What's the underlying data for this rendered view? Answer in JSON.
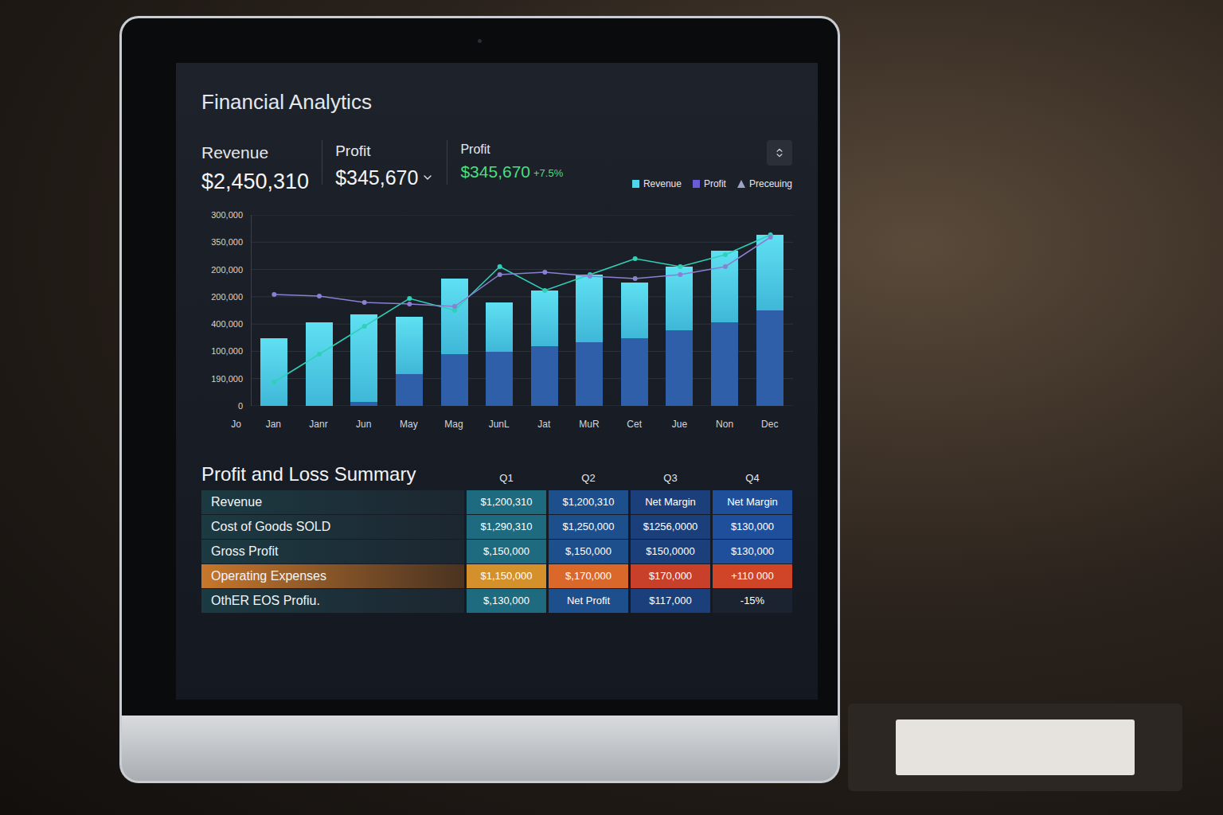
{
  "app": {
    "title": "Financial Analytics"
  },
  "kpis": [
    {
      "label": "Revenue",
      "value": "$2,450,310",
      "change": "",
      "dropdown": false,
      "positive": false
    },
    {
      "label": "Profit",
      "value": "$345,670",
      "change": "",
      "dropdown": true,
      "positive": false
    },
    {
      "label": "Profit",
      "value": "$345,670",
      "change": "+7.5%",
      "dropdown": false,
      "positive": true
    }
  ],
  "chart": {
    "legend": [
      {
        "label": "Revenue",
        "color": "#4fd6ec",
        "kind": "square"
      },
      {
        "label": "Profit",
        "color": "#6a5cd8",
        "kind": "square"
      },
      {
        "label": "Preceuing",
        "color": "#9aa3c8",
        "kind": "triangle"
      }
    ],
    "y_ticks": [
      "300,000",
      "350,000",
      "200,000",
      "200,000",
      "400,000",
      "100,000",
      "190,000",
      "0"
    ],
    "x_origin_label": "Jo",
    "bars": [
      {
        "label": "Jan",
        "total": 85000,
        "lower": 0
      },
      {
        "label": "Janr",
        "total": 105000,
        "lower": 0
      },
      {
        "label": "Jun",
        "total": 115000,
        "lower": 5000
      },
      {
        "label": "May",
        "total": 112000,
        "lower": 40000
      },
      {
        "label": "Mag",
        "total": 160000,
        "lower": 65000
      },
      {
        "label": "JunL",
        "total": 130000,
        "lower": 68000
      },
      {
        "label": "Jat",
        "total": 145000,
        "lower": 75000
      },
      {
        "label": "MuR",
        "total": 165000,
        "lower": 80000
      },
      {
        "label": "Cet",
        "total": 155000,
        "lower": 85000
      },
      {
        "label": "Jue",
        "total": 175000,
        "lower": 95000
      },
      {
        "label": "Non",
        "total": 195000,
        "lower": 105000
      },
      {
        "label": "Dec",
        "total": 215000,
        "lower": 120000
      }
    ],
    "lines": [
      {
        "color": "#2fd0b8",
        "values": [
          30000,
          65000,
          100000,
          135000,
          120000,
          175000,
          145000,
          165000,
          185000,
          175000,
          190000,
          215000
        ]
      },
      {
        "color": "#8a7fd0",
        "values": [
          140000,
          138000,
          130000,
          128000,
          125000,
          165000,
          168000,
          163000,
          160000,
          165000,
          175000,
          212000
        ]
      }
    ]
  },
  "table": {
    "title": "Profit and Loss Summary",
    "rows": [
      {
        "label": "Revenue",
        "highlighted": false
      },
      {
        "label": "Cost of Goods SOLD",
        "highlighted": false
      },
      {
        "label": "Gross Profit",
        "highlighted": false
      },
      {
        "label": "Operating Expenses",
        "highlighted": true
      },
      {
        "label": "OthER EOS Profiu.",
        "highlighted": false
      }
    ],
    "columns": [
      {
        "label": "Q1",
        "cells": [
          {
            "text": "$1,200,310",
            "color": "#1e6b80"
          },
          {
            "text": "$1,290,310",
            "color": "#1e6b80"
          },
          {
            "text": "$,150,000",
            "color": "#1e6b80"
          },
          {
            "text": "$1,150,000",
            "color": "#d4902a"
          },
          {
            "text": "$,130,000",
            "color": "#1e6b80"
          }
        ]
      },
      {
        "label": "Q2",
        "cells": [
          {
            "text": "$1,200,310",
            "color": "#1d4f8c"
          },
          {
            "text": "$1,250,000",
            "color": "#1d4f8c"
          },
          {
            "text": "$,150,000",
            "color": "#1d4f8c"
          },
          {
            "text": "$,170,000",
            "color": "#d9682a"
          },
          {
            "text": "Net Profit",
            "color": "#1d4f8c"
          }
        ]
      },
      {
        "label": "Q3",
        "cells": [
          {
            "text": "Net Margin",
            "color": "#1a3f7a"
          },
          {
            "text": "$1256,0000",
            "color": "#1a3f7a"
          },
          {
            "text": "$150,0000",
            "color": "#1a3f7a"
          },
          {
            "text": "$170,000",
            "color": "#c8402a"
          },
          {
            "text": "$117,000",
            "color": "#1a3f7a"
          }
        ]
      },
      {
        "label": "Q4",
        "cells": [
          {
            "text": "Net Margin",
            "color": "#1f4f9a"
          },
          {
            "text": "$130,000",
            "color": "#1f4f9a"
          },
          {
            "text": "$130,000",
            "color": "#1f4f9a"
          },
          {
            "text": "+110 000",
            "color": "#d04428"
          },
          {
            "text": "-15%",
            "color": "#1b2330"
          }
        ]
      }
    ]
  }
}
